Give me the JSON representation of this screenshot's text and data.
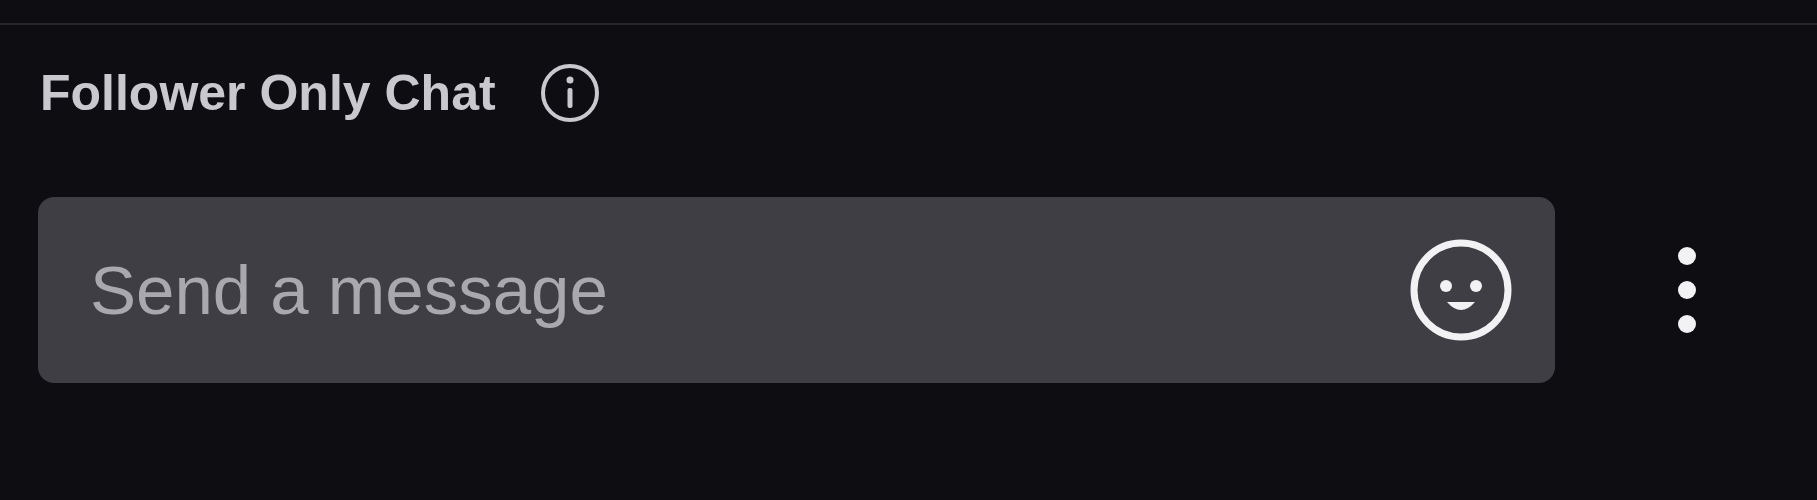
{
  "chat_header": {
    "title": "Follower Only Chat"
  },
  "message_input": {
    "placeholder": "Send a message"
  }
}
